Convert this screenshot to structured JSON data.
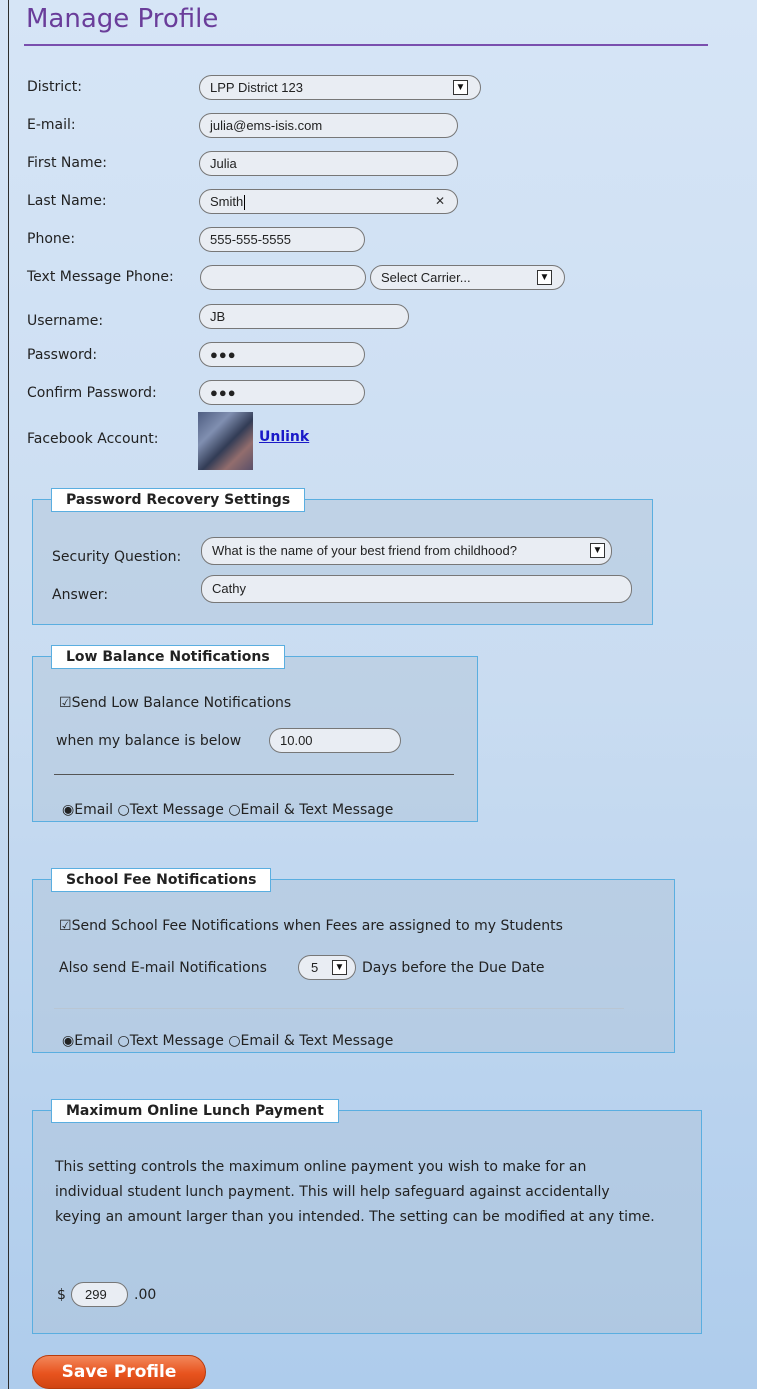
{
  "title": "Manage Profile",
  "profile": {
    "district_label": "District:",
    "district_value": "LPP District 123",
    "email_label": "E-mail:",
    "email_value": "julia@ems-isis.com",
    "first_name_label": "First Name:",
    "first_name_value": "Julia",
    "last_name_label": "Last Name:",
    "last_name_value": "Smith",
    "phone_label": "Phone:",
    "phone_value": "555-555-5555",
    "text_phone_label": "Text Message Phone:",
    "text_phone_value": "",
    "carrier_value": "Select Carrier...",
    "username_label": "Username:",
    "username_value": "JB",
    "password_label": "Password:",
    "password_mask": "●●●",
    "confirm_password_label": "Confirm Password:",
    "confirm_password_mask": "●●●",
    "facebook_label": "Facebook Account:",
    "facebook_link": "Unlink"
  },
  "recovery": {
    "legend": "Password Recovery Settings",
    "question_label": "Security Question:",
    "question_value": "What is the name of your best friend from childhood?",
    "answer_label": "Answer:",
    "answer_value": "Cathy"
  },
  "low_balance": {
    "legend": "Low Balance Notifications",
    "checkbox_label": "Send Low Balance Notifications",
    "threshold_label": "when my balance is below",
    "threshold_value": "10.00",
    "options": [
      "Email",
      "Text Message",
      "Email & Text Message"
    ],
    "selected": "Email"
  },
  "school_fee": {
    "legend": "School Fee Notifications",
    "checkbox_label": "Send School Fee Notifications when Fees are assigned to my Students",
    "also_send_label": "Also send E-mail Notifications",
    "days_value": "5",
    "days_suffix": "Days before the Due Date",
    "options": [
      "Email",
      "Text Message",
      "Email & Text Message"
    ],
    "selected": "Email"
  },
  "max_payment": {
    "legend": "Maximum Online Lunch Payment",
    "description": "This setting controls the maximum online payment you wish to make for an individual student lunch payment.  This will help safeguard against accidentally keying an amount larger than you intended.  The setting can be modified at any time.",
    "currency_symbol": "$",
    "amount_value": "299",
    "cents_suffix": ".00"
  },
  "save_button": "Save Profile",
  "icons": {
    "dropdown": "chevron-down-icon",
    "clear": "clear-x-icon",
    "checkbox_checked": "☑",
    "radio_on": "◉",
    "radio_off": "○"
  }
}
